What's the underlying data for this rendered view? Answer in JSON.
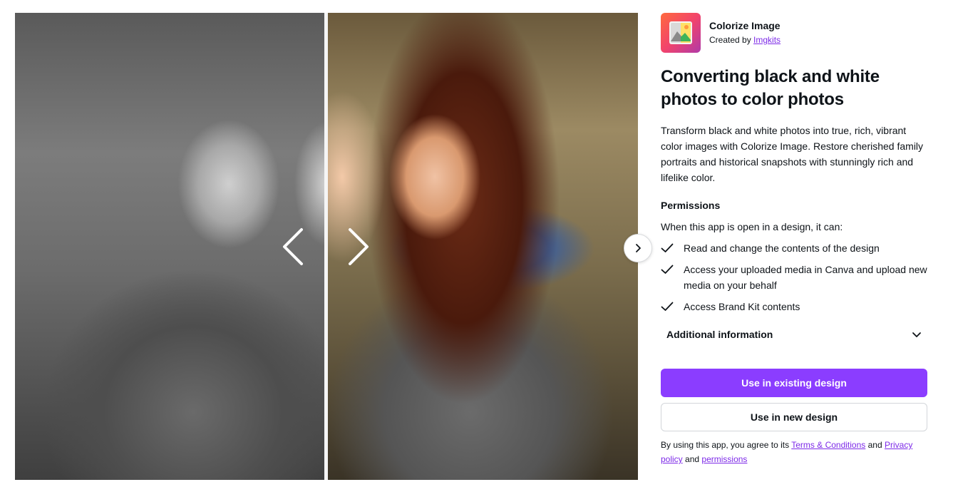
{
  "app": {
    "name": "Colorize Image",
    "created_by_prefix": "Created by",
    "creator": "Imgkits"
  },
  "title": "Converting black and white photos to color photos",
  "description": "Transform black and white photos into true, rich, vibrant color images with Colorize Image. Restore cherished family portraits and historical snapshots with stunningly rich and lifelike color.",
  "permissions": {
    "heading": "Permissions",
    "intro": "When this app is open in a design, it can:",
    "items": [
      "Read and change the contents of the design",
      "Access your uploaded media in Canva and upload new media on your behalf",
      "Access Brand Kit contents"
    ]
  },
  "additional_info": "Additional information",
  "buttons": {
    "primary": "Use in existing design",
    "secondary": "Use in new design"
  },
  "terms": {
    "prefix": "By using this app, you agree to its",
    "terms_link": "Terms & Conditions",
    "and1": "and",
    "privacy_link": "Privacy policy",
    "and2": "and",
    "permissions_link": "permissions"
  },
  "colors": {
    "accent": "#8b3dff",
    "link": "#7d2ae8",
    "text": "#0e1318"
  }
}
